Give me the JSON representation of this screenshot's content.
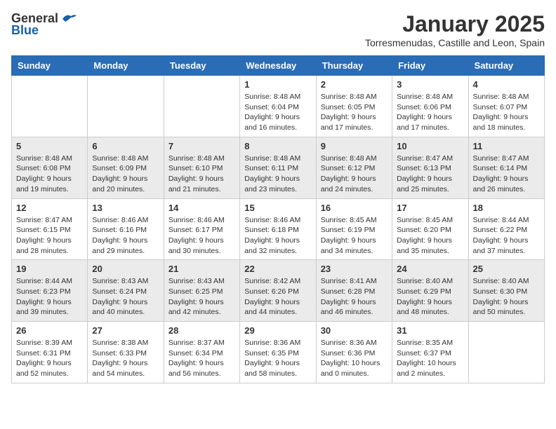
{
  "header": {
    "logo_general": "General",
    "logo_blue": "Blue",
    "month": "January 2025",
    "location": "Torresmenudas, Castille and Leon, Spain"
  },
  "days_of_week": [
    "Sunday",
    "Monday",
    "Tuesday",
    "Wednesday",
    "Thursday",
    "Friday",
    "Saturday"
  ],
  "weeks": [
    [
      {
        "day": "",
        "empty": true
      },
      {
        "day": "",
        "empty": true
      },
      {
        "day": "",
        "empty": true
      },
      {
        "day": "1",
        "sunrise": "Sunrise: 8:48 AM",
        "sunset": "Sunset: 6:04 PM",
        "daylight": "Daylight: 9 hours and 16 minutes."
      },
      {
        "day": "2",
        "sunrise": "Sunrise: 8:48 AM",
        "sunset": "Sunset: 6:05 PM",
        "daylight": "Daylight: 9 hours and 17 minutes."
      },
      {
        "day": "3",
        "sunrise": "Sunrise: 8:48 AM",
        "sunset": "Sunset: 6:06 PM",
        "daylight": "Daylight: 9 hours and 17 minutes."
      },
      {
        "day": "4",
        "sunrise": "Sunrise: 8:48 AM",
        "sunset": "Sunset: 6:07 PM",
        "daylight": "Daylight: 9 hours and 18 minutes."
      }
    ],
    [
      {
        "day": "5",
        "sunrise": "Sunrise: 8:48 AM",
        "sunset": "Sunset: 6:08 PM",
        "daylight": "Daylight: 9 hours and 19 minutes."
      },
      {
        "day": "6",
        "sunrise": "Sunrise: 8:48 AM",
        "sunset": "Sunset: 6:09 PM",
        "daylight": "Daylight: 9 hours and 20 minutes."
      },
      {
        "day": "7",
        "sunrise": "Sunrise: 8:48 AM",
        "sunset": "Sunset: 6:10 PM",
        "daylight": "Daylight: 9 hours and 21 minutes."
      },
      {
        "day": "8",
        "sunrise": "Sunrise: 8:48 AM",
        "sunset": "Sunset: 6:11 PM",
        "daylight": "Daylight: 9 hours and 23 minutes."
      },
      {
        "day": "9",
        "sunrise": "Sunrise: 8:48 AM",
        "sunset": "Sunset: 6:12 PM",
        "daylight": "Daylight: 9 hours and 24 minutes."
      },
      {
        "day": "10",
        "sunrise": "Sunrise: 8:47 AM",
        "sunset": "Sunset: 6:13 PM",
        "daylight": "Daylight: 9 hours and 25 minutes."
      },
      {
        "day": "11",
        "sunrise": "Sunrise: 8:47 AM",
        "sunset": "Sunset: 6:14 PM",
        "daylight": "Daylight: 9 hours and 26 minutes."
      }
    ],
    [
      {
        "day": "12",
        "sunrise": "Sunrise: 8:47 AM",
        "sunset": "Sunset: 6:15 PM",
        "daylight": "Daylight: 9 hours and 28 minutes."
      },
      {
        "day": "13",
        "sunrise": "Sunrise: 8:46 AM",
        "sunset": "Sunset: 6:16 PM",
        "daylight": "Daylight: 9 hours and 29 minutes."
      },
      {
        "day": "14",
        "sunrise": "Sunrise: 8:46 AM",
        "sunset": "Sunset: 6:17 PM",
        "daylight": "Daylight: 9 hours and 30 minutes."
      },
      {
        "day": "15",
        "sunrise": "Sunrise: 8:46 AM",
        "sunset": "Sunset: 6:18 PM",
        "daylight": "Daylight: 9 hours and 32 minutes."
      },
      {
        "day": "16",
        "sunrise": "Sunrise: 8:45 AM",
        "sunset": "Sunset: 6:19 PM",
        "daylight": "Daylight: 9 hours and 34 minutes."
      },
      {
        "day": "17",
        "sunrise": "Sunrise: 8:45 AM",
        "sunset": "Sunset: 6:20 PM",
        "daylight": "Daylight: 9 hours and 35 minutes."
      },
      {
        "day": "18",
        "sunrise": "Sunrise: 8:44 AM",
        "sunset": "Sunset: 6:22 PM",
        "daylight": "Daylight: 9 hours and 37 minutes."
      }
    ],
    [
      {
        "day": "19",
        "sunrise": "Sunrise: 8:44 AM",
        "sunset": "Sunset: 6:23 PM",
        "daylight": "Daylight: 9 hours and 39 minutes."
      },
      {
        "day": "20",
        "sunrise": "Sunrise: 8:43 AM",
        "sunset": "Sunset: 6:24 PM",
        "daylight": "Daylight: 9 hours and 40 minutes."
      },
      {
        "day": "21",
        "sunrise": "Sunrise: 8:43 AM",
        "sunset": "Sunset: 6:25 PM",
        "daylight": "Daylight: 9 hours and 42 minutes."
      },
      {
        "day": "22",
        "sunrise": "Sunrise: 8:42 AM",
        "sunset": "Sunset: 6:26 PM",
        "daylight": "Daylight: 9 hours and 44 minutes."
      },
      {
        "day": "23",
        "sunrise": "Sunrise: 8:41 AM",
        "sunset": "Sunset: 6:28 PM",
        "daylight": "Daylight: 9 hours and 46 minutes."
      },
      {
        "day": "24",
        "sunrise": "Sunrise: 8:40 AM",
        "sunset": "Sunset: 6:29 PM",
        "daylight": "Daylight: 9 hours and 48 minutes."
      },
      {
        "day": "25",
        "sunrise": "Sunrise: 8:40 AM",
        "sunset": "Sunset: 6:30 PM",
        "daylight": "Daylight: 9 hours and 50 minutes."
      }
    ],
    [
      {
        "day": "26",
        "sunrise": "Sunrise: 8:39 AM",
        "sunset": "Sunset: 6:31 PM",
        "daylight": "Daylight: 9 hours and 52 minutes."
      },
      {
        "day": "27",
        "sunrise": "Sunrise: 8:38 AM",
        "sunset": "Sunset: 6:33 PM",
        "daylight": "Daylight: 9 hours and 54 minutes."
      },
      {
        "day": "28",
        "sunrise": "Sunrise: 8:37 AM",
        "sunset": "Sunset: 6:34 PM",
        "daylight": "Daylight: 9 hours and 56 minutes."
      },
      {
        "day": "29",
        "sunrise": "Sunrise: 8:36 AM",
        "sunset": "Sunset: 6:35 PM",
        "daylight": "Daylight: 9 hours and 58 minutes."
      },
      {
        "day": "30",
        "sunrise": "Sunrise: 8:36 AM",
        "sunset": "Sunset: 6:36 PM",
        "daylight": "Daylight: 10 hours and 0 minutes."
      },
      {
        "day": "31",
        "sunrise": "Sunrise: 8:35 AM",
        "sunset": "Sunset: 6:37 PM",
        "daylight": "Daylight: 10 hours and 2 minutes."
      },
      {
        "day": "",
        "empty": true
      }
    ]
  ]
}
